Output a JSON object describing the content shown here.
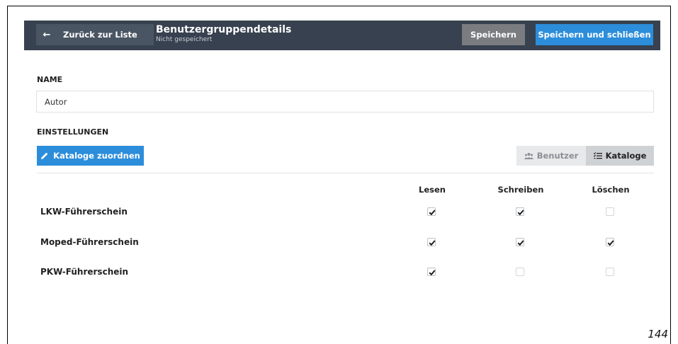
{
  "header": {
    "back_label": "Zurück zur Liste",
    "title": "Benutzergruppendetails",
    "subtitle": "Nicht gespeichert",
    "save_label": "Speichern",
    "save_close_label": "Speichern und schließen"
  },
  "name_section": {
    "label": "NAME",
    "value": "Autor"
  },
  "settings_section": {
    "label": "EINSTELLUNGEN",
    "assign_label": "Kataloge zuordnen",
    "view_toggle": {
      "users_label": "Benutzer",
      "catalogs_label": "Kataloge",
      "selected": "Kataloge"
    }
  },
  "permissions": {
    "columns": [
      "Lesen",
      "Schreiben",
      "Löschen"
    ],
    "rows": [
      {
        "name": "LKW-Führerschein",
        "lesen": true,
        "schreiben": true,
        "loeschen": false
      },
      {
        "name": "Moped-Führerschein",
        "lesen": true,
        "schreiben": true,
        "loeschen": true
      },
      {
        "name": "PKW-Führerschein",
        "lesen": true,
        "schreiben": false,
        "loeschen": false
      }
    ]
  },
  "footer": {
    "page_number": "144"
  },
  "colors": {
    "topbar": "#37414f",
    "primary": "#2c8ddb",
    "secondary": "#7a7c80"
  }
}
